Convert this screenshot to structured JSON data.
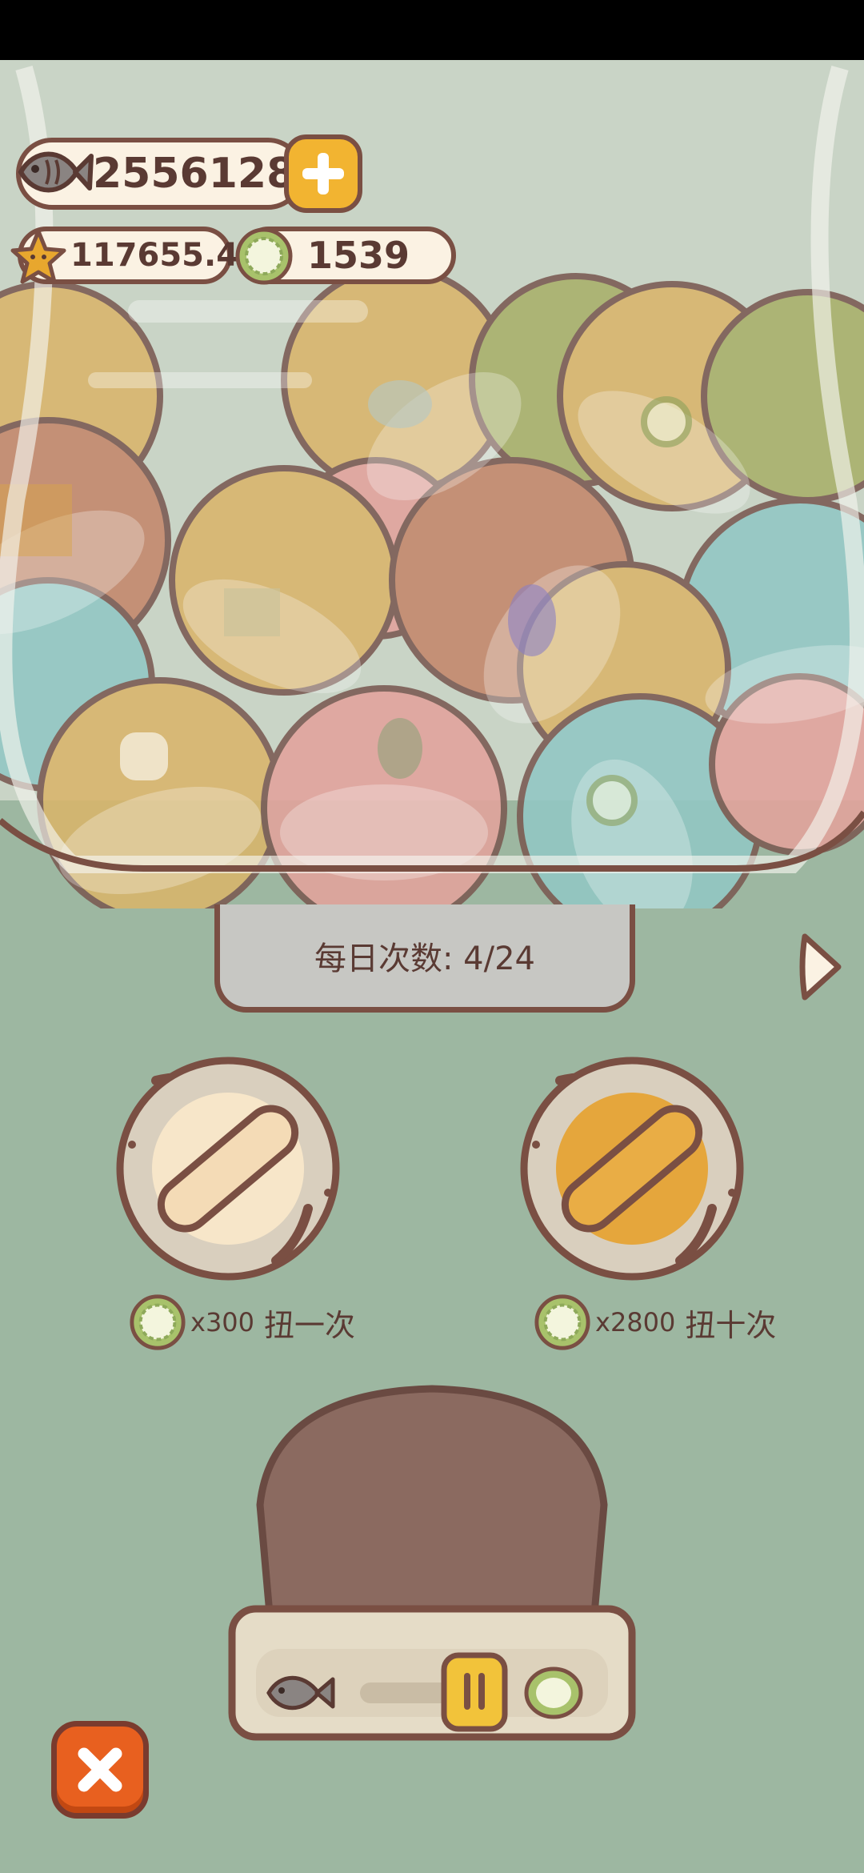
{
  "currency": {
    "fish_amount": "2556128",
    "star_amount": "117655.4",
    "coin_amount": "1539"
  },
  "daily": {
    "label": "每日次数: 4/24"
  },
  "gacha": {
    "single": {
      "multiplier": "x300",
      "action": "扭一次"
    },
    "ten": {
      "multiplier": "x2800",
      "action": "扭十次"
    }
  },
  "colors": {
    "background_top": "#c9d4c6",
    "background_bottom": "#9db7a1",
    "outline": "#7a4f43",
    "accent_yellow": "#f2b431",
    "close_orange": "#e8601f"
  },
  "icons": [
    "fish-icon",
    "plus-icon",
    "star-icon",
    "coin-icon",
    "arrow-right-icon",
    "close-icon"
  ]
}
